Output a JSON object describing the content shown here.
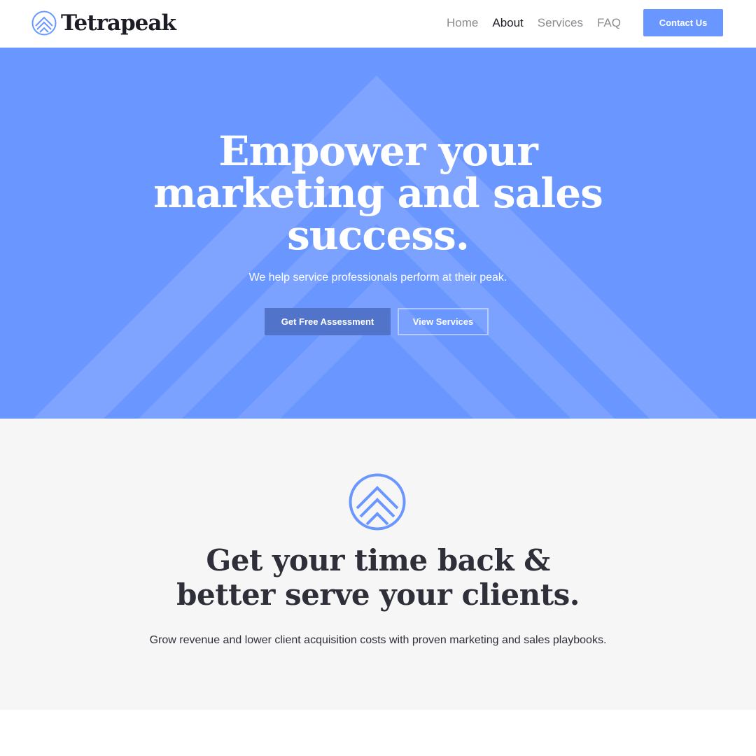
{
  "brand": {
    "name": "Tetrapeak",
    "logo_icon": "mountain-peak-circle-icon"
  },
  "nav": {
    "items": [
      {
        "label": "Home",
        "active": false
      },
      {
        "label": "About",
        "active": true
      },
      {
        "label": "Services",
        "active": false
      },
      {
        "label": "FAQ",
        "active": false
      }
    ],
    "contact_label": "Contact Us"
  },
  "hero": {
    "title": "Empower your marketing and sales success.",
    "subtitle": "We help service professionals perform at their peak.",
    "primary_button": "Get Free Assessment",
    "secondary_button": "View Services"
  },
  "section2": {
    "icon": "mountain-peak-circle-icon",
    "title_line1": "Get your time back &",
    "title_line2": "better serve your clients.",
    "subtitle": "Grow revenue and lower client acquisition costs with proven marketing and sales playbooks."
  },
  "colors": {
    "accent": "#6a96ff",
    "primary_button": "#5173c9",
    "dark_text": "#2f2f3a",
    "section_bg": "#f6f6f6"
  }
}
